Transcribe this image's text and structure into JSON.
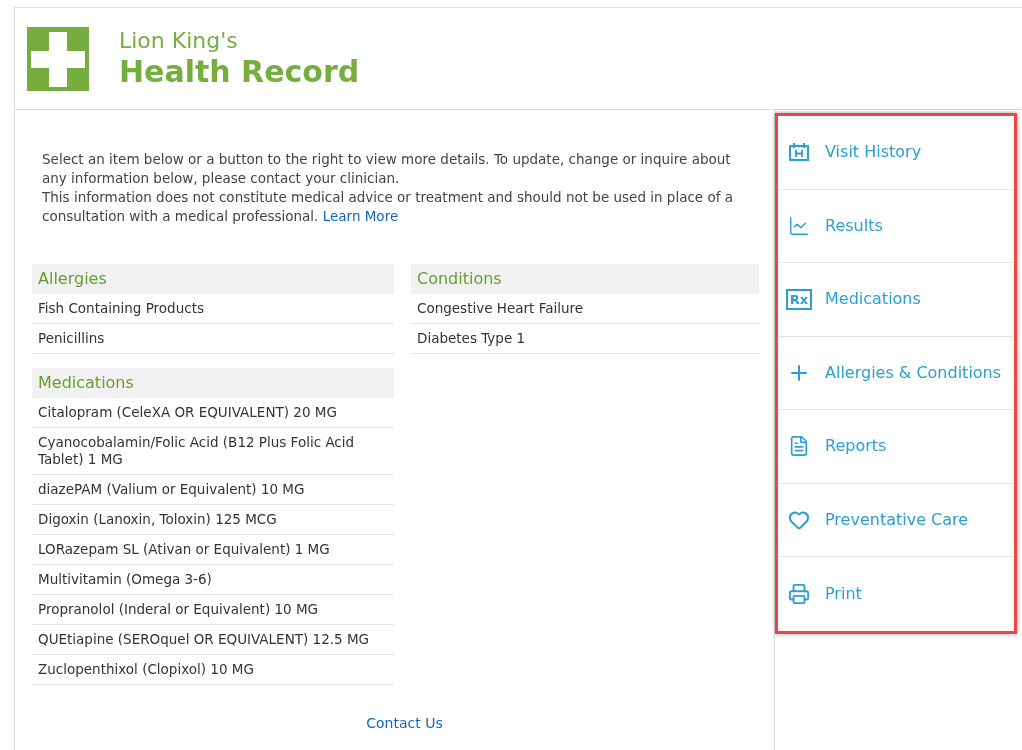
{
  "header": {
    "owner": "Lion King's",
    "title": "Health Record"
  },
  "intro": {
    "line_1": "Select an item below or a button to the right to view more details. To update, change or inquire about any information below, please contact your clinician.",
    "line_2": "This information does not constitute medical advice or treatment and should not be used in place of a consultation with a medical professional.",
    "link": "Learn More"
  },
  "left_sections": [
    {
      "title": "Allergies",
      "items": [
        "Fish Containing Products",
        "Penicillins"
      ]
    },
    {
      "title": "Medications",
      "items": [
        "Citalopram (CeleXA OR EQUIVALENT) 20 MG",
        "Cyanocobalamin/Folic Acid (B12 Plus Folic Acid Tablet) 1 MG",
        "diazePAM (Valium or Equivalent) 10 MG",
        "Digoxin (Lanoxin, Toloxin) 125 MCG",
        "LORazepam SL (Ativan or Equivalent) 1 MG",
        "Multivitamin (Omega 3-6)",
        "Propranolol (Inderal or Equivalent) 10 MG",
        "QUEtiapine (SEROquel OR EQUIVALENT) 12.5 MG",
        "Zuclopenthixol (Clopixol) 10 MG"
      ]
    }
  ],
  "right_sections": [
    {
      "title": "Conditions",
      "items": [
        "Congestive Heart Failure",
        "Diabetes Type 1"
      ]
    }
  ],
  "footer": {
    "link": "Contact Us"
  },
  "sidebar": {
    "highlighted": true,
    "items": [
      {
        "label": "Visit History",
        "kind": "calendar"
      },
      {
        "label": "Results",
        "kind": "chart"
      },
      {
        "label": "Medications",
        "kind": "rx",
        "icon_text": "Rx"
      },
      {
        "label": "Allergies & Conditions",
        "kind": "plus"
      },
      {
        "label": "Reports",
        "kind": "document"
      },
      {
        "label": "Preventative Care",
        "kind": "heart"
      },
      {
        "label": "Print",
        "kind": "printer"
      }
    ]
  }
}
